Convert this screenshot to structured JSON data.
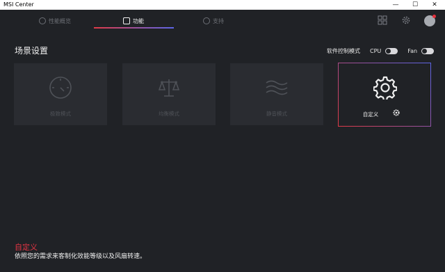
{
  "window": {
    "title": "MSI Center",
    "minimize_glyph": "—",
    "maximize_glyph": "☐",
    "close_glyph": "✕"
  },
  "nav": {
    "tabs": [
      {
        "label": "性能概览",
        "icon": "gauge-icon"
      },
      {
        "label": "功能",
        "icon": "feature-icon",
        "active": true
      },
      {
        "label": "支持",
        "icon": "support-icon"
      }
    ],
    "right_icons": [
      "grid-icon",
      "settings-icon",
      "user-avatar"
    ],
    "accent_gradient": [
      "#e13a47",
      "#5c66e8"
    ]
  },
  "section": {
    "title": "场景设置",
    "controls_label": "软件控制模式",
    "cpu_label": "CPU",
    "fan_label": "Fan"
  },
  "modes": [
    {
      "label": "极致模式",
      "icon": "speedometer-icon"
    },
    {
      "label": "均衡模式",
      "icon": "balance-scale-icon"
    },
    {
      "label": "静音模式",
      "icon": "wave-icon"
    },
    {
      "label": "自定义",
      "icon": "gear-icon",
      "selected": true
    }
  ],
  "footer": {
    "title": "自定义",
    "description": "依照您的需求来客制化效能等级以及风扇转速。"
  },
  "colors": {
    "background": "#202226",
    "card": "#2a2c31",
    "accent_red": "#e23443",
    "accent_blue": "#5c66e8"
  }
}
